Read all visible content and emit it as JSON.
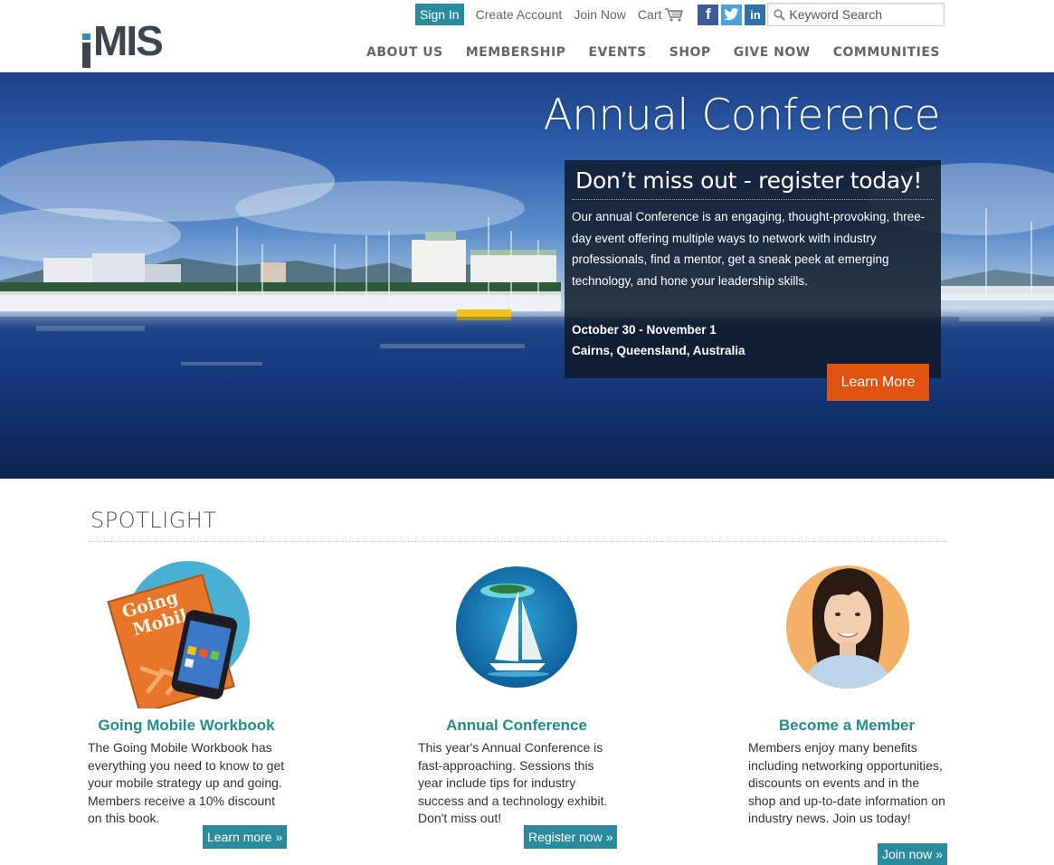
{
  "header": {
    "logo_text": "MIS",
    "utility": {
      "sign_in": "Sign In",
      "create_account": "Create Account",
      "join_now": "Join Now",
      "cart": "Cart"
    },
    "social": {
      "facebook": "f",
      "twitter": "t",
      "linkedin": "in"
    },
    "search": {
      "placeholder": "Keyword Search"
    },
    "nav": [
      "ABOUT US",
      "MEMBERSHIP",
      "EVENTS",
      "SHOP",
      "GIVE NOW",
      "COMMUNITIES"
    ]
  },
  "hero": {
    "title": "Annual Conference",
    "promo": {
      "heading": "Don’t miss out - register today!",
      "body": "Our annual Conference is an engaging, thought-provoking, three-day event offering multiple ways to network with industry professionals, find a mentor, get a sneak peek at emerging technology, and hone your leadership skills.",
      "dates": "October 30 - November 1",
      "location": "Cairns, Queensland, Australia",
      "button": "Learn More"
    }
  },
  "spotlight": {
    "title": "SPOTLIGHT",
    "cards": [
      {
        "image_text": [
          "Going",
          "Mobile"
        ],
        "title": "Going Mobile Workbook",
        "text": "The Going Mobile Workbook has everything you need to know to get your mobile strategy up and going. Members receive a 10% discount on this book.",
        "button": "Learn more »"
      },
      {
        "title": "Annual Conference",
        "text": "This year's Annual Conference is fast-approaching. Sessions this year include tips for industry success and a technology exhibit. Don't miss out!",
        "button": "Register now »"
      },
      {
        "title": "Become a Member",
        "text": "Members enjoy many benefits including networking opportunities, discounts on events and in the shop and up-to-date information on industry news. Join us today!",
        "button": "Join now »"
      }
    ]
  },
  "colors": {
    "brand_teal": "#2a8a9e",
    "title_teal": "#1f8f8c",
    "cta_orange": "#e1510f",
    "logo_dark": "#3d4650",
    "logo_blue": "#2a8bbd"
  }
}
